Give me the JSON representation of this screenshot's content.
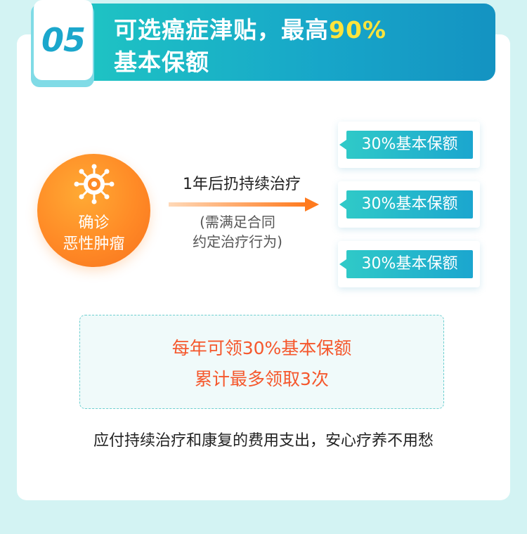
{
  "header": {
    "number": "05",
    "title_line1": "可选癌症津贴，最高",
    "title_highlight": "90%",
    "title_line2": "基本保额"
  },
  "diagnosis": {
    "line1": "确诊",
    "line2": "恶性肿瘤",
    "icon": "virus-icon"
  },
  "arrow": {
    "label": "1年后扔持续治疗",
    "note_line1": "(需满足合同",
    "note_line2": "约定治疗行为)"
  },
  "options": [
    {
      "label": "30%基本保额"
    },
    {
      "label": "30%基本保额"
    },
    {
      "label": "30%基本保额"
    }
  ],
  "summary": {
    "line1": "每年可领30%基本保额",
    "line2": "累计最多领取3次"
  },
  "footer": {
    "text": "应付持续治疗和康复的费用支出，安心疗养不用愁"
  },
  "colors": {
    "accent_teal": "#1fc6c3",
    "accent_blue": "#1493c2",
    "highlight_yellow": "#ffe43b",
    "orange": "#ff8a26",
    "red_text": "#f5572c",
    "background": "#d3f3f3"
  }
}
